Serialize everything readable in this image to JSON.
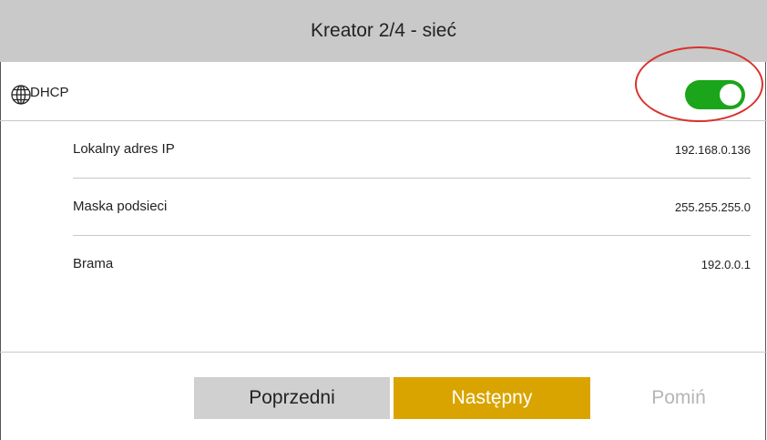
{
  "header": {
    "title": "Kreator 2/4 - sieć"
  },
  "dhcp": {
    "icon": "globe-icon",
    "label": "DHCP",
    "enabled": true,
    "toggle_color": "#1aa51a"
  },
  "settings": [
    {
      "label": "Lokalny adres IP",
      "value": "192.168.0.136"
    },
    {
      "label": "Maska podsieci",
      "value": "255.255.255.0"
    },
    {
      "label": "Brama",
      "value": "192.0.0.1"
    }
  ],
  "buttons": {
    "prev_label": "Poprzedni",
    "next_label": "Następny",
    "skip_label": "Pomiń"
  },
  "colors": {
    "header_bg": "#c9c9c9",
    "next_button": "#d9a400",
    "highlight": "#d8322c"
  }
}
